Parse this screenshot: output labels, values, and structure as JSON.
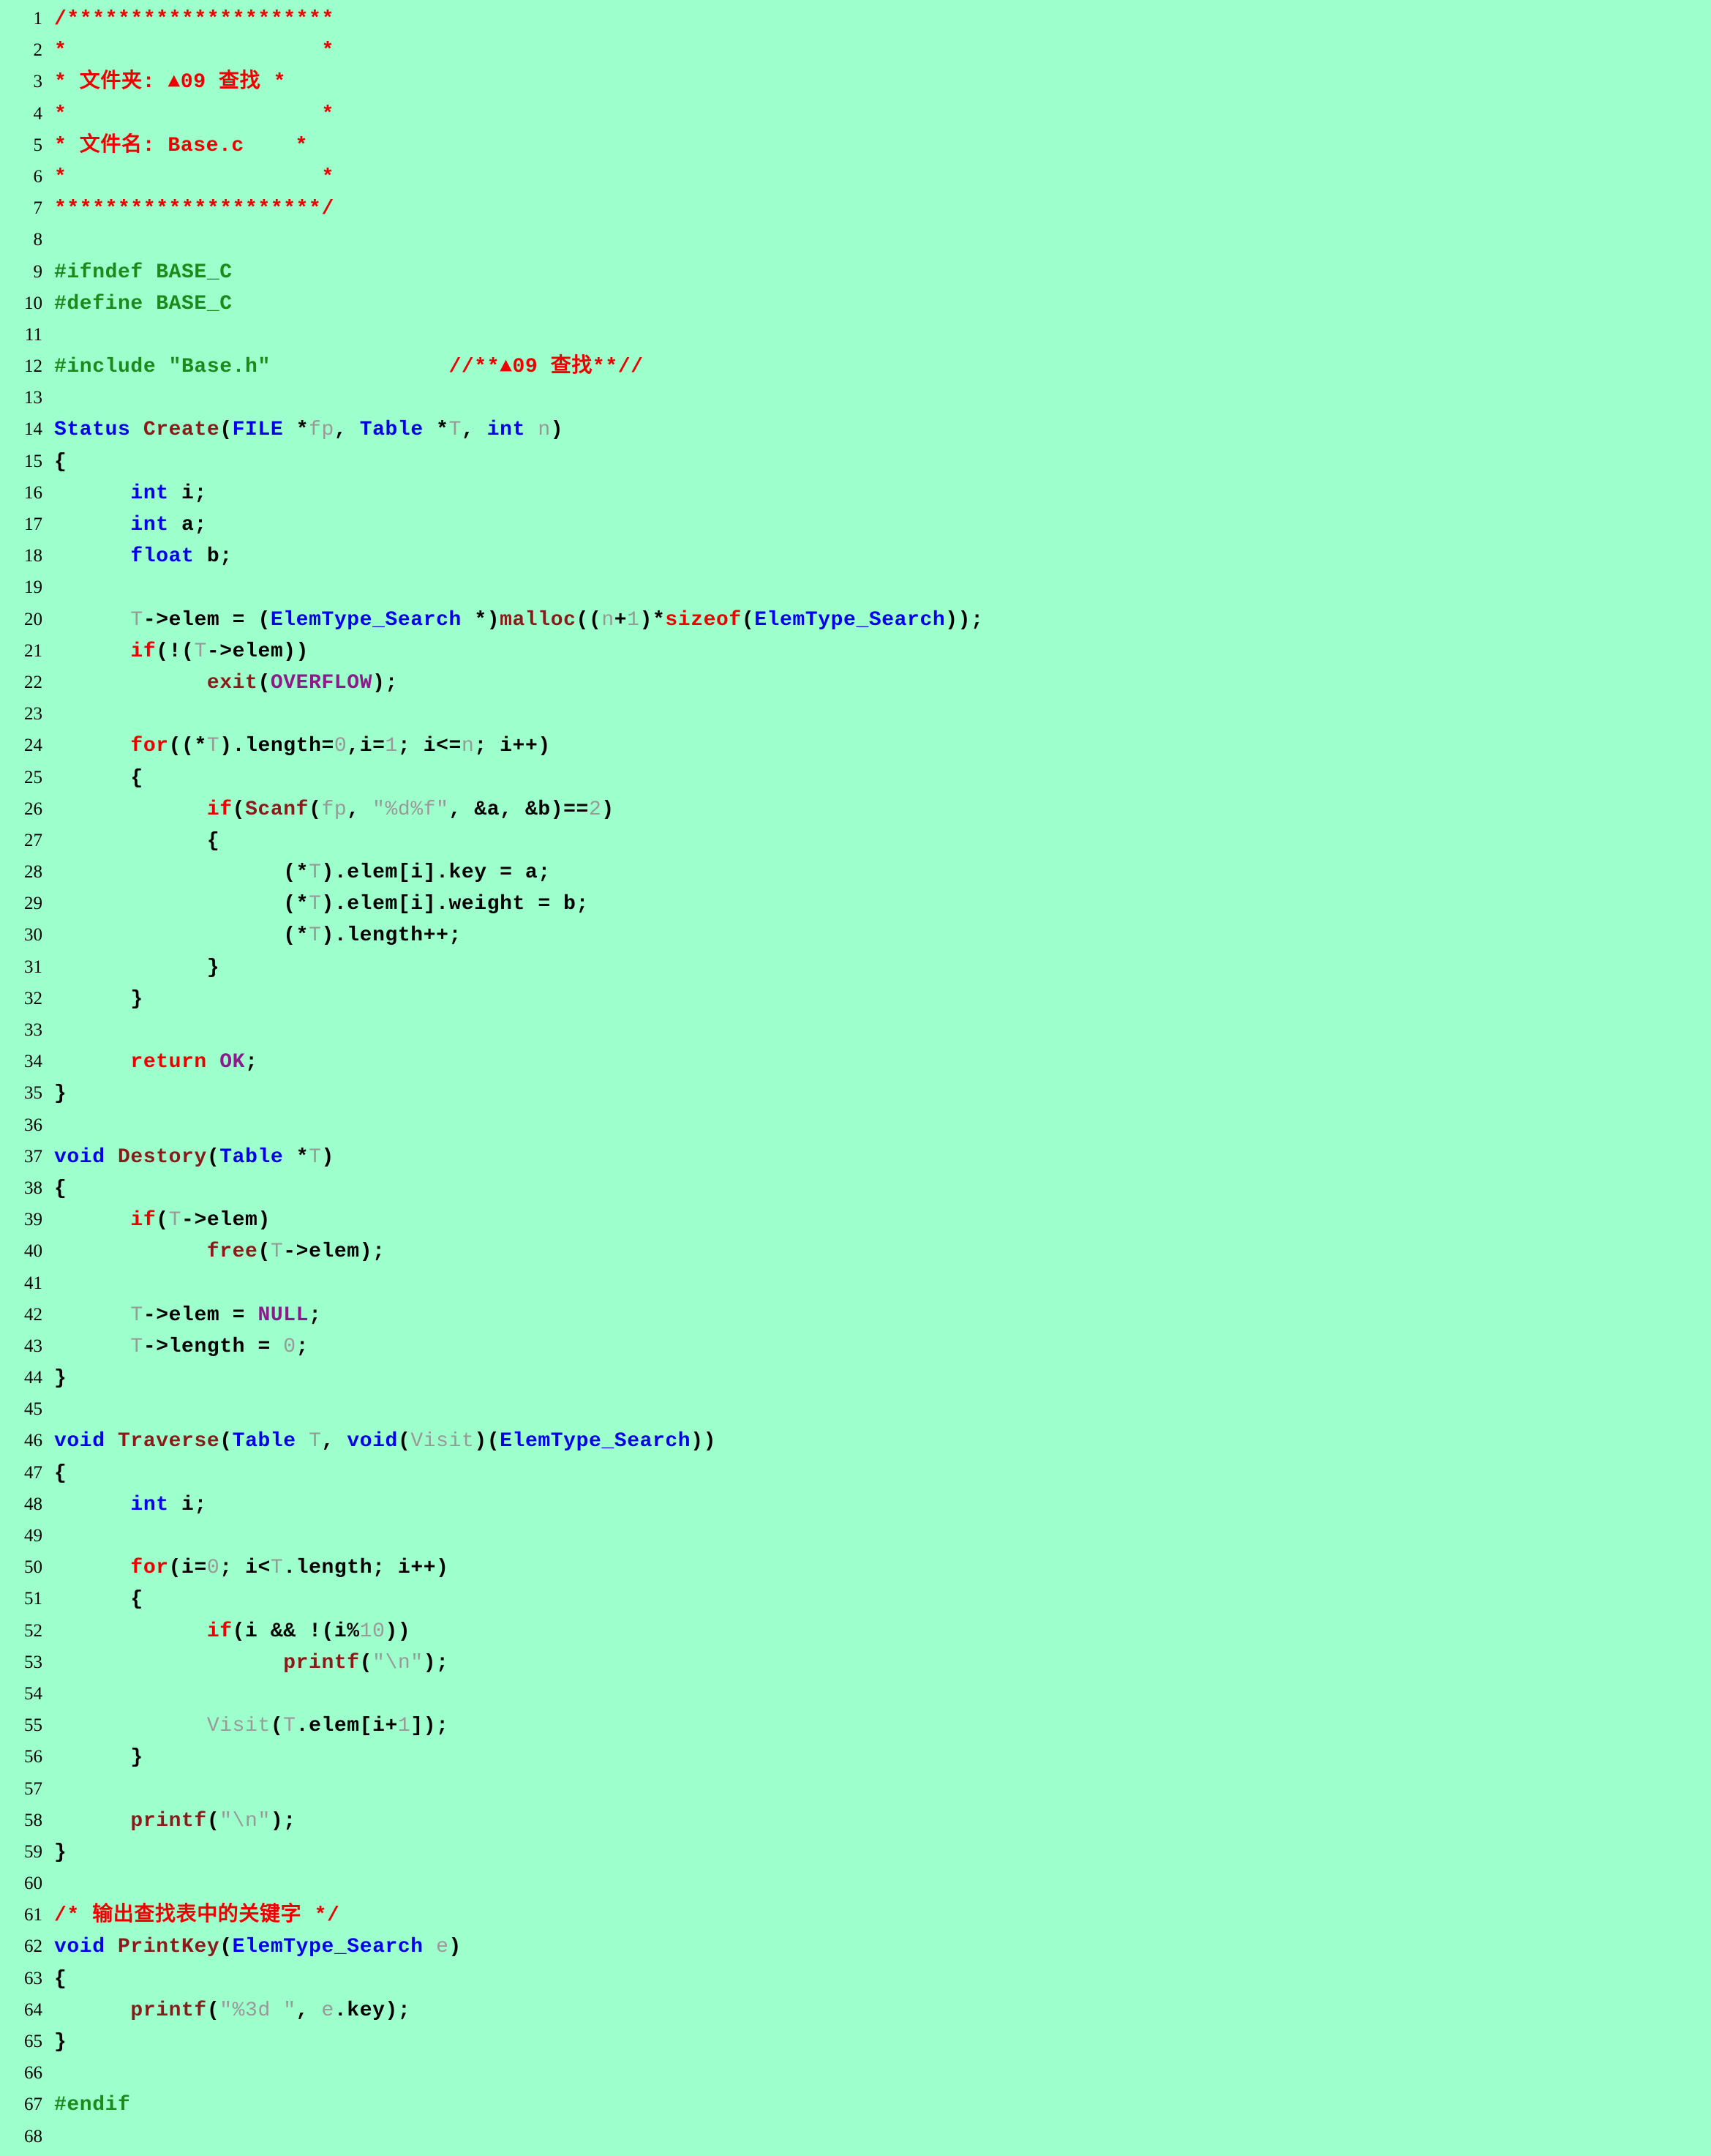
{
  "document": {
    "filename": "Base.c",
    "language": "C",
    "background_color": "#9dffcc",
    "total_lines": 68
  },
  "palette": {
    "preprocessor": "#1a8a1a",
    "comment": "#ee0000",
    "keyword": "#0000ee",
    "control": "#ee0000",
    "function": "#8b1a1a",
    "constant": "#8b1a8b",
    "identifier": "#999999",
    "string": "#999999",
    "number": "#999999",
    "plain": "#000000",
    "line_number": "#000000"
  },
  "lines": [
    {
      "n": "1",
      "tokens": [
        {
          "c": "cmt",
          "t": "/*********************"
        }
      ]
    },
    {
      "n": "2",
      "tokens": [
        {
          "c": "cmt",
          "t": "*                    *"
        }
      ]
    },
    {
      "n": "3",
      "tokens": [
        {
          "c": "cmt",
          "t": "* 文件夹: ▲09 查找 *"
        }
      ]
    },
    {
      "n": "4",
      "tokens": [
        {
          "c": "cmt",
          "t": "*                    *"
        }
      ]
    },
    {
      "n": "5",
      "tokens": [
        {
          "c": "cmt",
          "t": "* 文件名: Base.c    *"
        }
      ]
    },
    {
      "n": "6",
      "tokens": [
        {
          "c": "cmt",
          "t": "*                    *"
        }
      ]
    },
    {
      "n": "7",
      "tokens": [
        {
          "c": "cmt",
          "t": "*********************/"
        }
      ]
    },
    {
      "n": "8",
      "tokens": []
    },
    {
      "n": "9",
      "tokens": [
        {
          "c": "pre",
          "t": "#ifndef BASE_C"
        }
      ]
    },
    {
      "n": "10",
      "tokens": [
        {
          "c": "pre",
          "t": "#define BASE_C"
        }
      ]
    },
    {
      "n": "11",
      "tokens": []
    },
    {
      "n": "12",
      "tokens": [
        {
          "c": "pre",
          "t": "#include \"Base.h\""
        },
        {
          "c": "plain",
          "t": "              "
        },
        {
          "c": "cmt",
          "t": "//**▲09 查找**//"
        }
      ]
    },
    {
      "n": "13",
      "tokens": []
    },
    {
      "n": "14",
      "tokens": [
        {
          "c": "kw",
          "t": "Status"
        },
        {
          "c": "plain",
          "t": " "
        },
        {
          "c": "fn",
          "t": "Create"
        },
        {
          "c": "op",
          "t": "("
        },
        {
          "c": "kw",
          "t": "FILE"
        },
        {
          "c": "plain",
          "t": " "
        },
        {
          "c": "op",
          "t": "*"
        },
        {
          "c": "id",
          "t": "fp"
        },
        {
          "c": "op",
          "t": ", "
        },
        {
          "c": "kw",
          "t": "Table"
        },
        {
          "c": "plain",
          "t": " "
        },
        {
          "c": "op",
          "t": "*"
        },
        {
          "c": "id",
          "t": "T"
        },
        {
          "c": "op",
          "t": ", "
        },
        {
          "c": "kw",
          "t": "int"
        },
        {
          "c": "plain",
          "t": " "
        },
        {
          "c": "id",
          "t": "n"
        },
        {
          "c": "op",
          "t": ")"
        }
      ]
    },
    {
      "n": "15",
      "tokens": [
        {
          "c": "op",
          "t": "{"
        }
      ]
    },
    {
      "n": "16",
      "tokens": [
        {
          "c": "plain",
          "t": "      "
        },
        {
          "c": "kw",
          "t": "int"
        },
        {
          "c": "op",
          "t": " i;"
        }
      ]
    },
    {
      "n": "17",
      "tokens": [
        {
          "c": "plain",
          "t": "      "
        },
        {
          "c": "kw",
          "t": "int"
        },
        {
          "c": "op",
          "t": " a;"
        }
      ]
    },
    {
      "n": "18",
      "tokens": [
        {
          "c": "plain",
          "t": "      "
        },
        {
          "c": "kw",
          "t": "float"
        },
        {
          "c": "op",
          "t": " b;"
        }
      ]
    },
    {
      "n": "19",
      "tokens": []
    },
    {
      "n": "20",
      "tokens": [
        {
          "c": "plain",
          "t": "      "
        },
        {
          "c": "id",
          "t": "T"
        },
        {
          "c": "op",
          "t": "->elem = ("
        },
        {
          "c": "kw",
          "t": "ElemType_Search"
        },
        {
          "c": "plain",
          "t": " "
        },
        {
          "c": "op",
          "t": "*)"
        },
        {
          "c": "fn",
          "t": "malloc"
        },
        {
          "c": "op",
          "t": "(("
        },
        {
          "c": "id",
          "t": "n"
        },
        {
          "c": "op",
          "t": "+"
        },
        {
          "c": "num",
          "t": "1"
        },
        {
          "c": "op",
          "t": ")*"
        },
        {
          "c": "ctl",
          "t": "sizeof"
        },
        {
          "c": "op",
          "t": "("
        },
        {
          "c": "kw",
          "t": "ElemType_Search"
        },
        {
          "c": "op",
          "t": "));"
        }
      ]
    },
    {
      "n": "21",
      "tokens": [
        {
          "c": "plain",
          "t": "      "
        },
        {
          "c": "ctl",
          "t": "if"
        },
        {
          "c": "op",
          "t": "(!("
        },
        {
          "c": "id",
          "t": "T"
        },
        {
          "c": "op",
          "t": "->elem))"
        }
      ]
    },
    {
      "n": "22",
      "tokens": [
        {
          "c": "plain",
          "t": "            "
        },
        {
          "c": "fn",
          "t": "exit"
        },
        {
          "c": "op",
          "t": "("
        },
        {
          "c": "const",
          "t": "OVERFLOW"
        },
        {
          "c": "op",
          "t": ");"
        }
      ]
    },
    {
      "n": "23",
      "tokens": []
    },
    {
      "n": "24",
      "tokens": [
        {
          "c": "plain",
          "t": "      "
        },
        {
          "c": "ctl",
          "t": "for"
        },
        {
          "c": "op",
          "t": "(("
        },
        {
          "c": "op",
          "t": "*"
        },
        {
          "c": "id",
          "t": "T"
        },
        {
          "c": "op",
          "t": ").length="
        },
        {
          "c": "num",
          "t": "0"
        },
        {
          "c": "op",
          "t": ",i="
        },
        {
          "c": "num",
          "t": "1"
        },
        {
          "c": "op",
          "t": "; i<="
        },
        {
          "c": "id",
          "t": "n"
        },
        {
          "c": "op",
          "t": "; i++)"
        }
      ]
    },
    {
      "n": "25",
      "tokens": [
        {
          "c": "plain",
          "t": "      "
        },
        {
          "c": "op",
          "t": "{"
        }
      ]
    },
    {
      "n": "26",
      "tokens": [
        {
          "c": "plain",
          "t": "            "
        },
        {
          "c": "ctl",
          "t": "if"
        },
        {
          "c": "op",
          "t": "("
        },
        {
          "c": "fn",
          "t": "Scanf"
        },
        {
          "c": "op",
          "t": "("
        },
        {
          "c": "id",
          "t": "fp"
        },
        {
          "c": "op",
          "t": ", "
        },
        {
          "c": "str",
          "t": "\"%d%f\""
        },
        {
          "c": "op",
          "t": ", &a, &b)=="
        },
        {
          "c": "num",
          "t": "2"
        },
        {
          "c": "op",
          "t": ")"
        }
      ]
    },
    {
      "n": "27",
      "tokens": [
        {
          "c": "plain",
          "t": "            "
        },
        {
          "c": "op",
          "t": "{"
        }
      ]
    },
    {
      "n": "28",
      "tokens": [
        {
          "c": "plain",
          "t": "                  "
        },
        {
          "c": "op",
          "t": "(*"
        },
        {
          "c": "id",
          "t": "T"
        },
        {
          "c": "op",
          "t": ").elem[i].key = a;"
        }
      ]
    },
    {
      "n": "29",
      "tokens": [
        {
          "c": "plain",
          "t": "                  "
        },
        {
          "c": "op",
          "t": "(*"
        },
        {
          "c": "id",
          "t": "T"
        },
        {
          "c": "op",
          "t": ").elem[i].weight = b;"
        }
      ]
    },
    {
      "n": "30",
      "tokens": [
        {
          "c": "plain",
          "t": "                  "
        },
        {
          "c": "op",
          "t": "(*"
        },
        {
          "c": "id",
          "t": "T"
        },
        {
          "c": "op",
          "t": ").length++;"
        }
      ]
    },
    {
      "n": "31",
      "tokens": [
        {
          "c": "plain",
          "t": "            "
        },
        {
          "c": "op",
          "t": "}"
        }
      ]
    },
    {
      "n": "32",
      "tokens": [
        {
          "c": "plain",
          "t": "      "
        },
        {
          "c": "op",
          "t": "}"
        }
      ]
    },
    {
      "n": "33",
      "tokens": []
    },
    {
      "n": "34",
      "tokens": [
        {
          "c": "plain",
          "t": "      "
        },
        {
          "c": "ctl",
          "t": "return"
        },
        {
          "c": "plain",
          "t": " "
        },
        {
          "c": "const",
          "t": "OK"
        },
        {
          "c": "op",
          "t": ";"
        }
      ]
    },
    {
      "n": "35",
      "tokens": [
        {
          "c": "op",
          "t": "}"
        }
      ]
    },
    {
      "n": "36",
      "tokens": []
    },
    {
      "n": "37",
      "tokens": [
        {
          "c": "kw",
          "t": "void"
        },
        {
          "c": "plain",
          "t": " "
        },
        {
          "c": "fn",
          "t": "Destory"
        },
        {
          "c": "op",
          "t": "("
        },
        {
          "c": "kw",
          "t": "Table"
        },
        {
          "c": "plain",
          "t": " "
        },
        {
          "c": "op",
          "t": "*"
        },
        {
          "c": "id",
          "t": "T"
        },
        {
          "c": "op",
          "t": ")"
        }
      ]
    },
    {
      "n": "38",
      "tokens": [
        {
          "c": "op",
          "t": "{"
        }
      ]
    },
    {
      "n": "39",
      "tokens": [
        {
          "c": "plain",
          "t": "      "
        },
        {
          "c": "ctl",
          "t": "if"
        },
        {
          "c": "op",
          "t": "("
        },
        {
          "c": "id",
          "t": "T"
        },
        {
          "c": "op",
          "t": "->elem)"
        }
      ]
    },
    {
      "n": "40",
      "tokens": [
        {
          "c": "plain",
          "t": "            "
        },
        {
          "c": "fn",
          "t": "free"
        },
        {
          "c": "op",
          "t": "("
        },
        {
          "c": "id",
          "t": "T"
        },
        {
          "c": "op",
          "t": "->elem);"
        }
      ]
    },
    {
      "n": "41",
      "tokens": []
    },
    {
      "n": "42",
      "tokens": [
        {
          "c": "plain",
          "t": "      "
        },
        {
          "c": "id",
          "t": "T"
        },
        {
          "c": "op",
          "t": "->elem = "
        },
        {
          "c": "const",
          "t": "NULL"
        },
        {
          "c": "op",
          "t": ";"
        }
      ]
    },
    {
      "n": "43",
      "tokens": [
        {
          "c": "plain",
          "t": "      "
        },
        {
          "c": "id",
          "t": "T"
        },
        {
          "c": "op",
          "t": "->length = "
        },
        {
          "c": "num",
          "t": "0"
        },
        {
          "c": "op",
          "t": ";"
        }
      ]
    },
    {
      "n": "44",
      "tokens": [
        {
          "c": "op",
          "t": "}"
        }
      ]
    },
    {
      "n": "45",
      "tokens": []
    },
    {
      "n": "46",
      "tokens": [
        {
          "c": "kw",
          "t": "void"
        },
        {
          "c": "plain",
          "t": " "
        },
        {
          "c": "fn",
          "t": "Traverse"
        },
        {
          "c": "op",
          "t": "("
        },
        {
          "c": "kw",
          "t": "Table"
        },
        {
          "c": "plain",
          "t": " "
        },
        {
          "c": "id",
          "t": "T"
        },
        {
          "c": "op",
          "t": ", "
        },
        {
          "c": "kw",
          "t": "void"
        },
        {
          "c": "op",
          "t": "("
        },
        {
          "c": "id",
          "t": "Visit"
        },
        {
          "c": "op",
          "t": ")("
        },
        {
          "c": "kw",
          "t": "ElemType_Search"
        },
        {
          "c": "op",
          "t": "))"
        }
      ]
    },
    {
      "n": "47",
      "tokens": [
        {
          "c": "op",
          "t": "{"
        }
      ]
    },
    {
      "n": "48",
      "tokens": [
        {
          "c": "plain",
          "t": "      "
        },
        {
          "c": "kw",
          "t": "int"
        },
        {
          "c": "op",
          "t": " i;"
        }
      ]
    },
    {
      "n": "49",
      "tokens": []
    },
    {
      "n": "50",
      "tokens": [
        {
          "c": "plain",
          "t": "      "
        },
        {
          "c": "ctl",
          "t": "for"
        },
        {
          "c": "op",
          "t": "(i="
        },
        {
          "c": "num",
          "t": "0"
        },
        {
          "c": "op",
          "t": "; i<"
        },
        {
          "c": "id",
          "t": "T"
        },
        {
          "c": "op",
          "t": ".length; i++)"
        }
      ]
    },
    {
      "n": "51",
      "tokens": [
        {
          "c": "plain",
          "t": "      "
        },
        {
          "c": "op",
          "t": "{"
        }
      ]
    },
    {
      "n": "52",
      "tokens": [
        {
          "c": "plain",
          "t": "            "
        },
        {
          "c": "ctl",
          "t": "if"
        },
        {
          "c": "op",
          "t": "(i && !(i%"
        },
        {
          "c": "num",
          "t": "10"
        },
        {
          "c": "op",
          "t": "))"
        }
      ]
    },
    {
      "n": "53",
      "tokens": [
        {
          "c": "plain",
          "t": "                  "
        },
        {
          "c": "fn",
          "t": "printf"
        },
        {
          "c": "op",
          "t": "("
        },
        {
          "c": "str",
          "t": "\"\\n\""
        },
        {
          "c": "op",
          "t": ");"
        }
      ]
    },
    {
      "n": "54",
      "tokens": []
    },
    {
      "n": "55",
      "tokens": [
        {
          "c": "plain",
          "t": "            "
        },
        {
          "c": "id",
          "t": "Visit"
        },
        {
          "c": "op",
          "t": "("
        },
        {
          "c": "id",
          "t": "T"
        },
        {
          "c": "op",
          "t": ".elem[i+"
        },
        {
          "c": "num",
          "t": "1"
        },
        {
          "c": "op",
          "t": "]);"
        }
      ]
    },
    {
      "n": "56",
      "tokens": [
        {
          "c": "plain",
          "t": "      "
        },
        {
          "c": "op",
          "t": "}"
        }
      ]
    },
    {
      "n": "57",
      "tokens": []
    },
    {
      "n": "58",
      "tokens": [
        {
          "c": "plain",
          "t": "      "
        },
        {
          "c": "fn",
          "t": "printf"
        },
        {
          "c": "op",
          "t": "("
        },
        {
          "c": "str",
          "t": "\"\\n\""
        },
        {
          "c": "op",
          "t": ");"
        }
      ]
    },
    {
      "n": "59",
      "tokens": [
        {
          "c": "op",
          "t": "}"
        }
      ]
    },
    {
      "n": "60",
      "tokens": []
    },
    {
      "n": "61",
      "tokens": [
        {
          "c": "cmt",
          "t": "/* 输出查找表中的关键字 */"
        }
      ]
    },
    {
      "n": "62",
      "tokens": [
        {
          "c": "kw",
          "t": "void"
        },
        {
          "c": "plain",
          "t": " "
        },
        {
          "c": "fn",
          "t": "PrintKey"
        },
        {
          "c": "op",
          "t": "("
        },
        {
          "c": "kw",
          "t": "ElemType_Search"
        },
        {
          "c": "plain",
          "t": " "
        },
        {
          "c": "id",
          "t": "e"
        },
        {
          "c": "op",
          "t": ")"
        }
      ]
    },
    {
      "n": "63",
      "tokens": [
        {
          "c": "op",
          "t": "{"
        }
      ]
    },
    {
      "n": "64",
      "tokens": [
        {
          "c": "plain",
          "t": "      "
        },
        {
          "c": "fn",
          "t": "printf"
        },
        {
          "c": "op",
          "t": "("
        },
        {
          "c": "str",
          "t": "\"%3d \""
        },
        {
          "c": "op",
          "t": ", "
        },
        {
          "c": "id",
          "t": "e"
        },
        {
          "c": "op",
          "t": ".key);"
        }
      ]
    },
    {
      "n": "65",
      "tokens": [
        {
          "c": "op",
          "t": "}"
        }
      ]
    },
    {
      "n": "66",
      "tokens": []
    },
    {
      "n": "67",
      "tokens": [
        {
          "c": "pre",
          "t": "#endif"
        }
      ]
    },
    {
      "n": "68",
      "tokens": []
    }
  ]
}
